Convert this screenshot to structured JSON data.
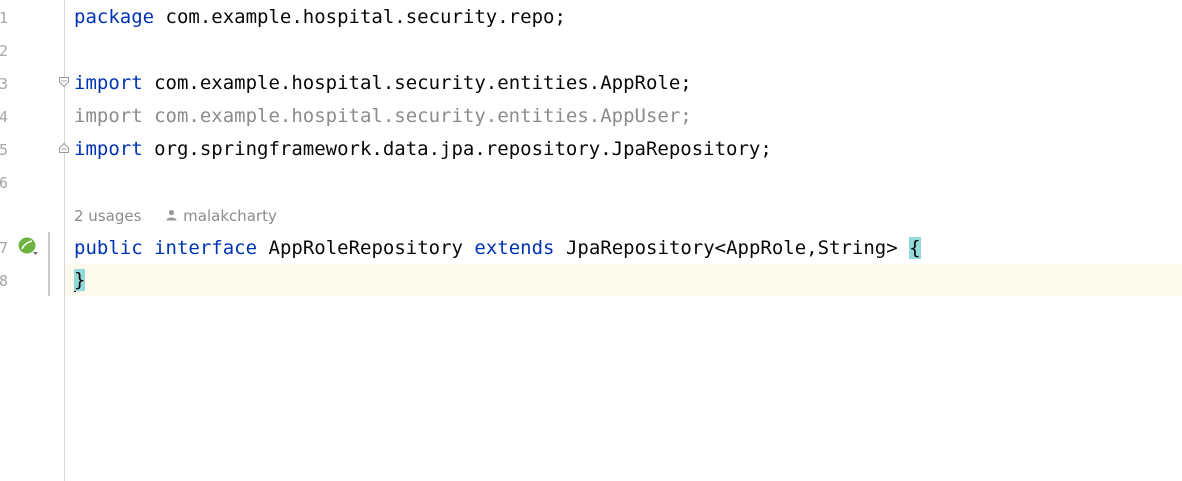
{
  "gutter": {
    "line_numbers": [
      "1",
      "2",
      "3",
      "4",
      "5",
      "6",
      "7",
      "8"
    ]
  },
  "code": {
    "line1": {
      "keyword": "package",
      "rest": " com.example.hospital.security.repo;"
    },
    "line3": {
      "keyword": "import",
      "rest": " com.example.hospital.security.entities.AppRole;"
    },
    "line4": {
      "text": "import com.example.hospital.security.entities.AppUser;"
    },
    "line5": {
      "keyword": "import",
      "rest": " org.springframework.data.jpa.repository.JpaRepository;"
    },
    "line7": {
      "kw_public": "public",
      "kw_interface": "interface",
      "name": "AppRoleRepository",
      "kw_extends": "extends",
      "parent": "JpaRepository<AppRole,String>",
      "open_brace": "{"
    },
    "line8": {
      "close_brace": "}"
    }
  },
  "inlay_hints": {
    "usages": "2 usages",
    "author": "malakcharty"
  },
  "icons": {
    "gutter_line7": "spring-bean-icon",
    "author": "person-icon"
  },
  "colors": {
    "keyword": "#0033b3",
    "unused_import": "#8c8c8c",
    "brace_highlight": "#93d9d9",
    "current_line": "#fcfaed",
    "bean_icon": "#6db33f"
  }
}
